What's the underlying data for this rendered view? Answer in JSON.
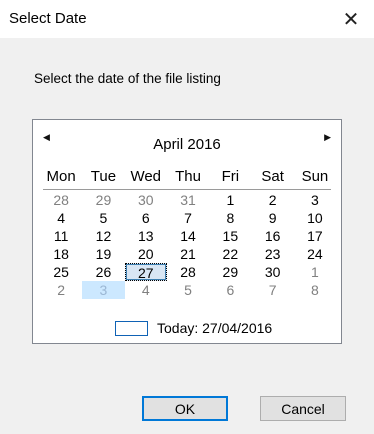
{
  "window": {
    "title": "Select Date",
    "close_glyph": "✕"
  },
  "prompt": "Select the date of the file listing",
  "calendar": {
    "prev_glyph": "◀",
    "next_glyph": "▶",
    "month_title": "April 2016",
    "weekdays": [
      "Mon",
      "Tue",
      "Wed",
      "Thu",
      "Fri",
      "Sat",
      "Sun"
    ],
    "weeks": [
      [
        "28",
        "29",
        "30",
        "31",
        "1",
        "2",
        "3"
      ],
      [
        "4",
        "5",
        "6",
        "7",
        "8",
        "9",
        "10"
      ],
      [
        "11",
        "12",
        "13",
        "14",
        "15",
        "16",
        "17"
      ],
      [
        "18",
        "19",
        "20",
        "21",
        "22",
        "23",
        "24"
      ],
      [
        "25",
        "26",
        "27",
        "28",
        "29",
        "30",
        "1"
      ],
      [
        "2",
        "3",
        "4",
        "5",
        "6",
        "7",
        "8"
      ]
    ],
    "today_label": "Today: 27/04/2016",
    "selected_color": "#0078d7"
  },
  "buttons": {
    "ok": "OK",
    "cancel": "Cancel"
  }
}
